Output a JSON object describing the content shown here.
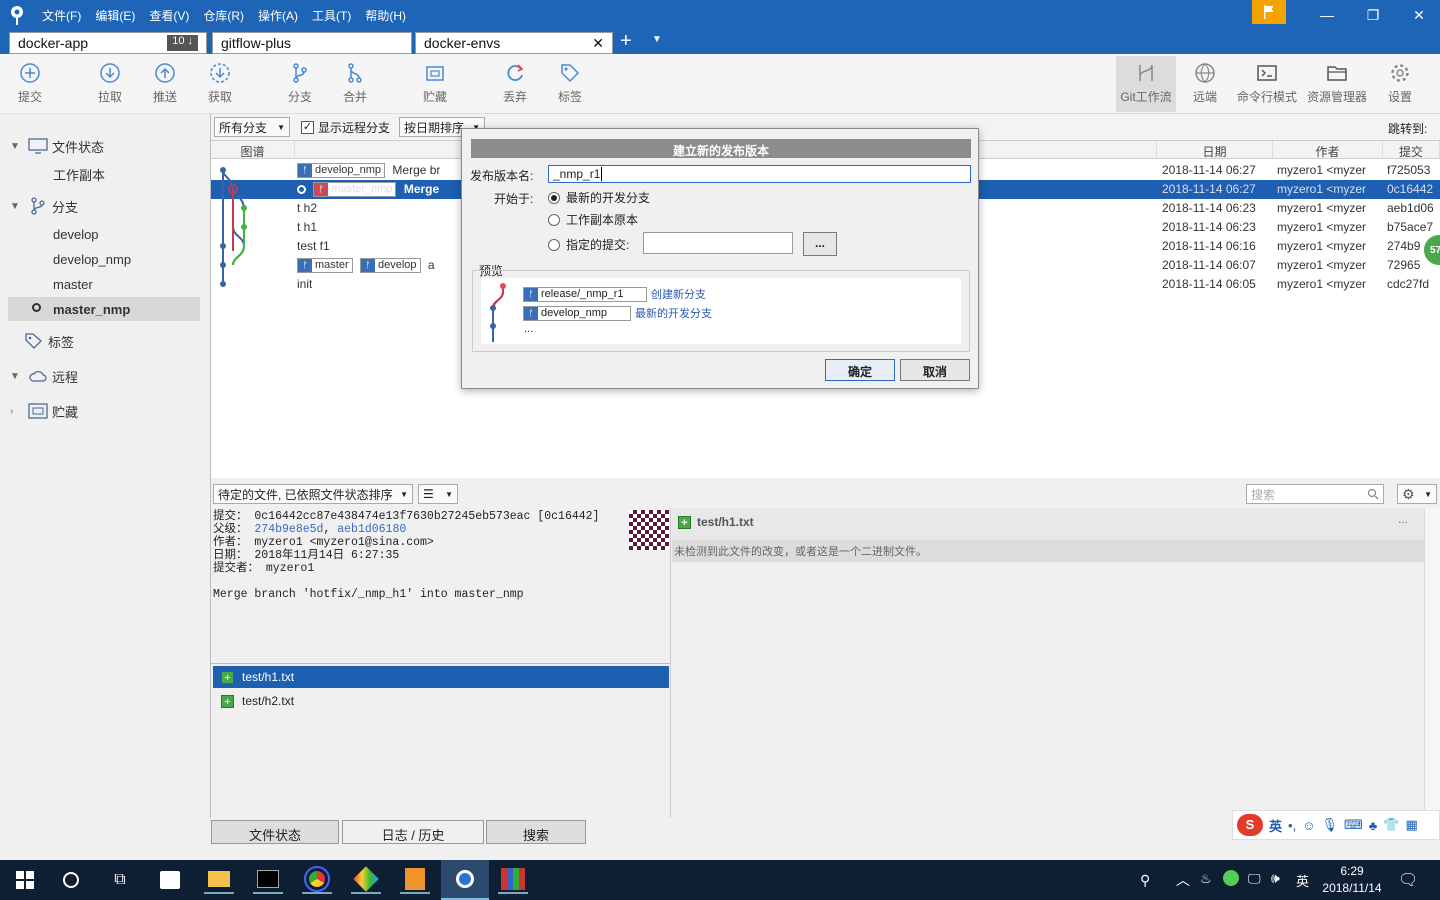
{
  "menu": [
    "文件(F)",
    "编辑(E)",
    "查看(V)",
    "仓库(R)",
    "操作(A)",
    "工具(T)",
    "帮助(H)"
  ],
  "tabs": [
    {
      "label": "docker-app",
      "badge": "10 ↓"
    },
    {
      "label": "gitflow-plus"
    },
    {
      "label": "docker-envs"
    }
  ],
  "toolbar": {
    "commit": "提交",
    "pull": "拉取",
    "push": "推送",
    "fetch": "获取",
    "branch": "分支",
    "merge": "合并",
    "stash": "贮藏",
    "discard": "丢弃",
    "tag": "标签",
    "gitflow": "Git工作流",
    "remote": "远端",
    "terminal": "命令行模式",
    "explorer": "资源管理器",
    "settings": "设置"
  },
  "sidebar": {
    "file_status": "文件状态",
    "working_copy": "工作副本",
    "branches": "分支",
    "branch_items": [
      "develop",
      "develop_nmp",
      "master",
      "master_nmp"
    ],
    "tags": "标签",
    "remote": "远程",
    "stash": "贮藏"
  },
  "graph_header": {
    "branch_filter": "所有分支",
    "show_remote": "显示远程分支",
    "sort": "按日期排序",
    "jump": "跳转到:"
  },
  "columns": {
    "graph": "图谱",
    "date": "日期",
    "author": "作者",
    "commit": "提交"
  },
  "commits": [
    {
      "tags": [
        "develop_nmp"
      ],
      "desc": "Merge br",
      "date": "2018-11-14 06:27",
      "author": "myzero1 <myzer",
      "hash": "f725053"
    },
    {
      "tags": [
        "master_nmp"
      ],
      "desc": "Merge",
      "date": "2018-11-14 06:27",
      "author": "myzero1 <myzer",
      "hash": "0c16442"
    },
    {
      "tags": [],
      "desc": "t h2",
      "date": "2018-11-14 06:23",
      "author": "myzero1 <myzer",
      "hash": "aeb1d06"
    },
    {
      "tags": [],
      "desc": "t h1",
      "date": "2018-11-14 06:23",
      "author": "myzero1 <myzer",
      "hash": "b75ace7"
    },
    {
      "tags": [],
      "desc": "test f1",
      "date": "2018-11-14 06:16",
      "author": "myzero1 <myzer",
      "hash": "274b9"
    },
    {
      "tags": [
        "master",
        "develop"
      ],
      "desc": "a",
      "date": "2018-11-14 06:07",
      "author": "myzero1 <myzer",
      "hash": "72965"
    },
    {
      "tags": [],
      "desc": "init",
      "date": "2018-11-14 06:05",
      "author": "myzero1 <myzer",
      "hash": "cdc27fd"
    }
  ],
  "lower": {
    "file_sort": "待定的文件, 已依照文件状态排序",
    "search_placeholder": "搜索"
  },
  "commit_info": {
    "commit_label": "提交：",
    "commit_value": "0c16442cc87e438474e13f7630b27245eb573eac [0c16442]",
    "parents_label": "父级：",
    "parent1": "274b9e8e5d",
    "parent2": "aeb1d06180",
    "author_label": "作者：",
    "author_value": "myzero1 <myzero1@sina.com>",
    "date_label": "日期：",
    "date_value": "2018年11月14日 6:27:35",
    "committer_label": "提交者：",
    "committer_value": "myzero1",
    "message": "Merge branch 'hotfix/_nmp_h1' into master_nmp"
  },
  "files": [
    "test/h1.txt",
    "test/h2.txt"
  ],
  "diff": {
    "file": "test/h1.txt",
    "message": "未检测到此文件的改变，或者这是一个二进制文件。",
    "menu": "..."
  },
  "bottom_tabs": [
    "文件状态",
    "日志 / 历史",
    "搜索"
  ],
  "dialog": {
    "title": "建立新的发布版本",
    "name_label": "发布版本名:",
    "name_value": "_nmp_r1",
    "start_label": "开始于:",
    "opt_latest": "最新的开发分支",
    "opt_working": "工作副本原本",
    "opt_commit": "指定的提交:",
    "browse": "...",
    "preview_label": "预览",
    "preview": [
      {
        "branch": "release/_nmp_r1",
        "note": "创建新分支"
      },
      {
        "branch": "develop_nmp",
        "note": "最新的开发分支"
      }
    ],
    "ellipsis": "...",
    "ok": "确定",
    "cancel": "取消"
  },
  "badge_green": "57",
  "ime": {
    "lang": "英"
  },
  "taskbar": {
    "ime": "英",
    "time": "6:29",
    "date": "2018/11/14"
  },
  "colors": {
    "titlebar": "#1f65b7",
    "selection": "#1d5fb0",
    "flag": "#f5a300"
  }
}
